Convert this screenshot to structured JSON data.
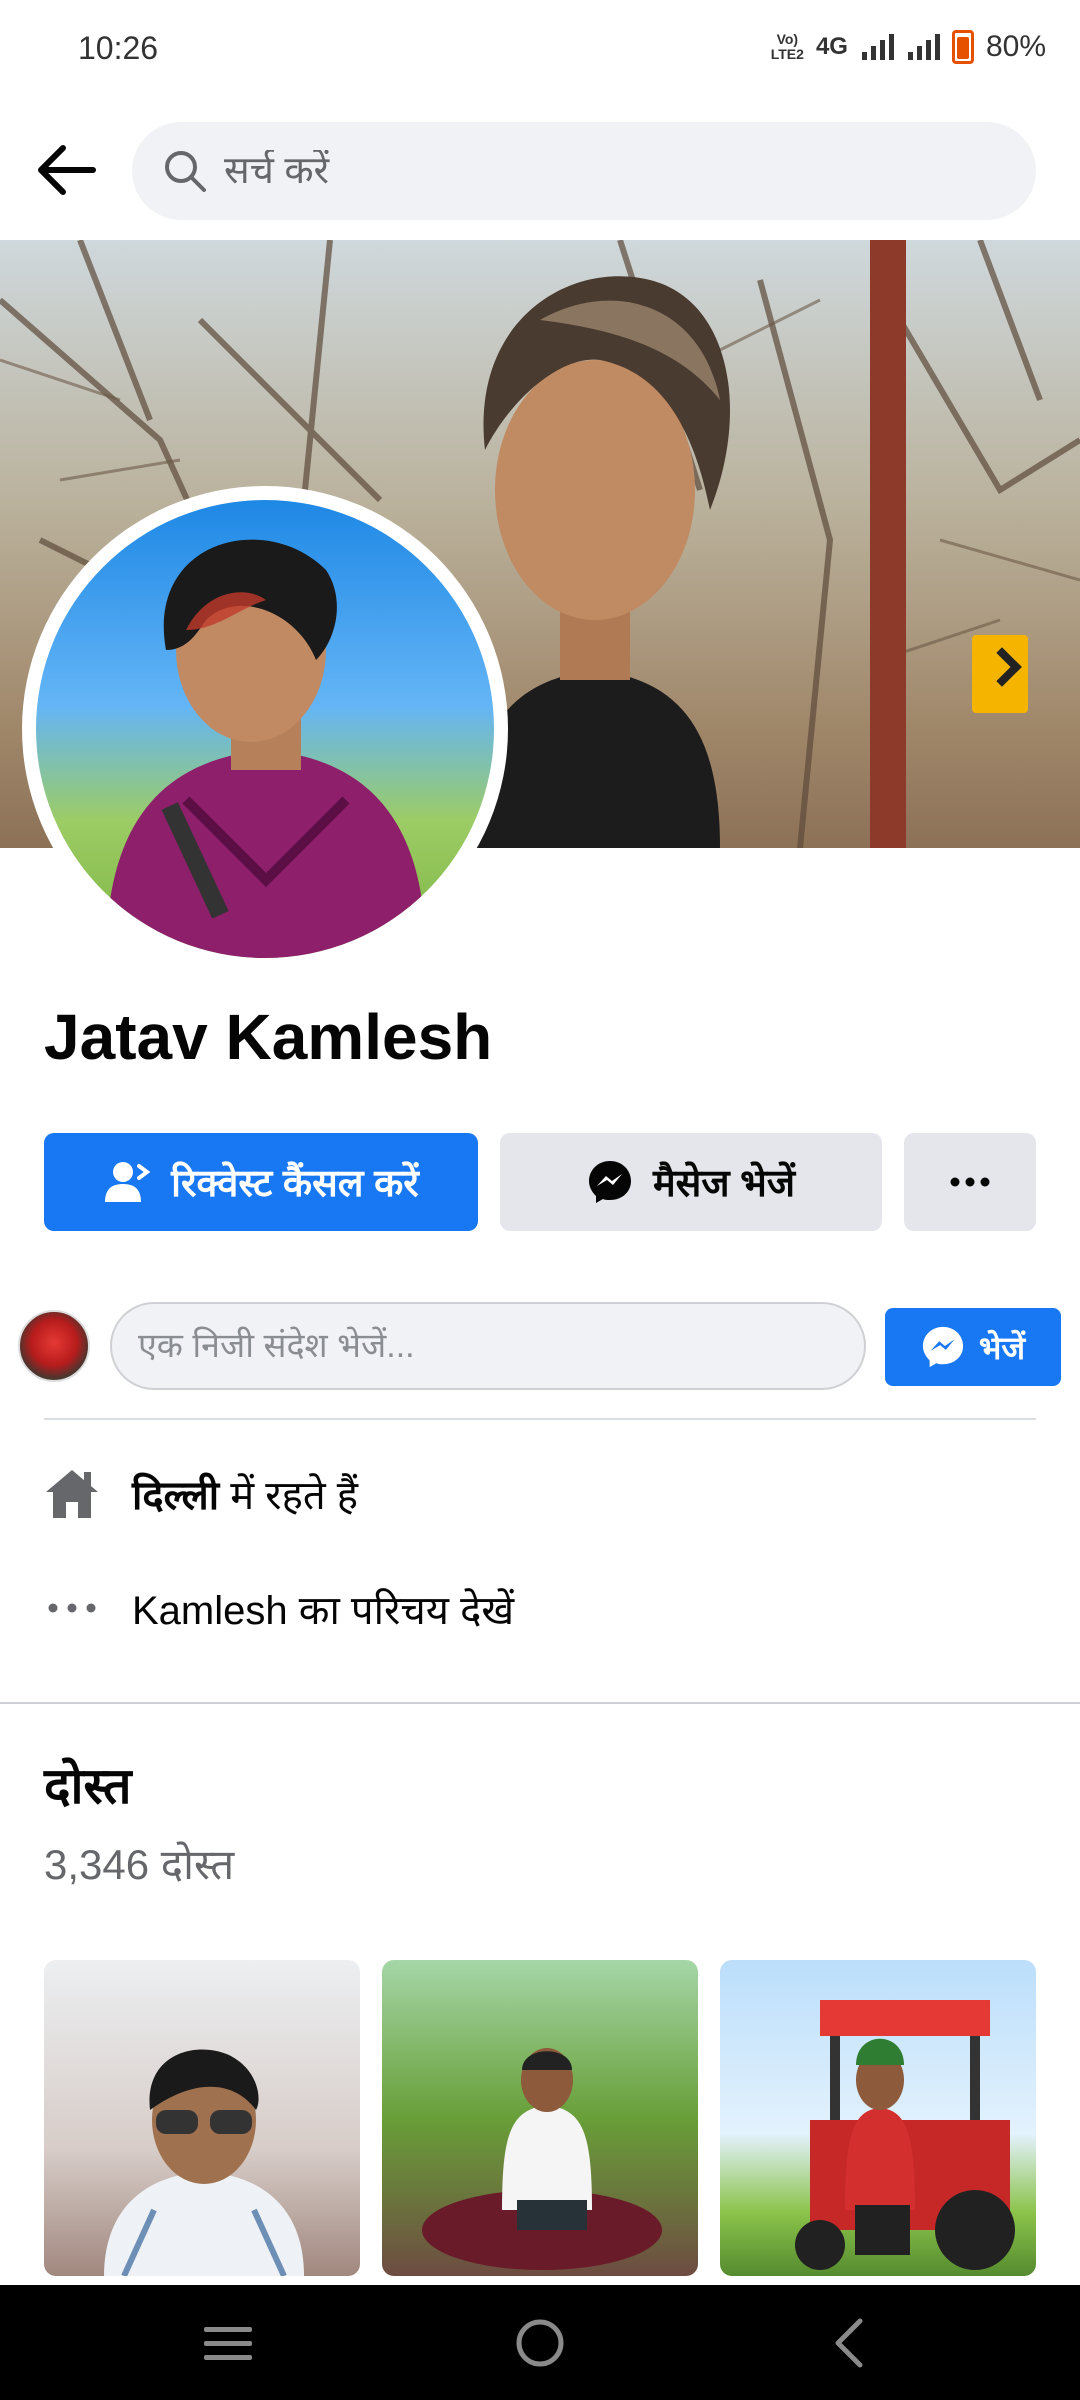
{
  "status_bar": {
    "time": "10:26",
    "volte_line1": "Vo)",
    "volte_line2": "LTE2",
    "network": "4G",
    "battery_percent": "80%",
    "battery_color": "#e65100"
  },
  "top_bar": {
    "back_icon": "arrow-left-icon",
    "search_placeholder": "सर्च करें",
    "search_icon": "search-icon"
  },
  "profile": {
    "name": "Jatav Kamlesh"
  },
  "actions": {
    "cancel_request_label": "रिक्वेस्ट कैंसल करें",
    "message_label": "मैसेज भेजें",
    "more_icon": "more-horizontal-icon"
  },
  "private_message": {
    "placeholder": "एक निजी संदेश भेजें...",
    "send_label": "भेजें"
  },
  "intro": {
    "lives_in_city": "दिल्ली",
    "lives_in_suffix": " में रहते हैं",
    "about_link": "Kamlesh का परिचय देखें"
  },
  "friends": {
    "title": "दोस्त",
    "count": "3,346 दोस्त"
  },
  "colors": {
    "accent": "#1877f2",
    "secondary_button": "#e4e6eb"
  },
  "nav_bar": {
    "menu_icon": "menu-icon",
    "home_icon": "home-circle-icon",
    "back_icon": "back-chevron-icon"
  }
}
